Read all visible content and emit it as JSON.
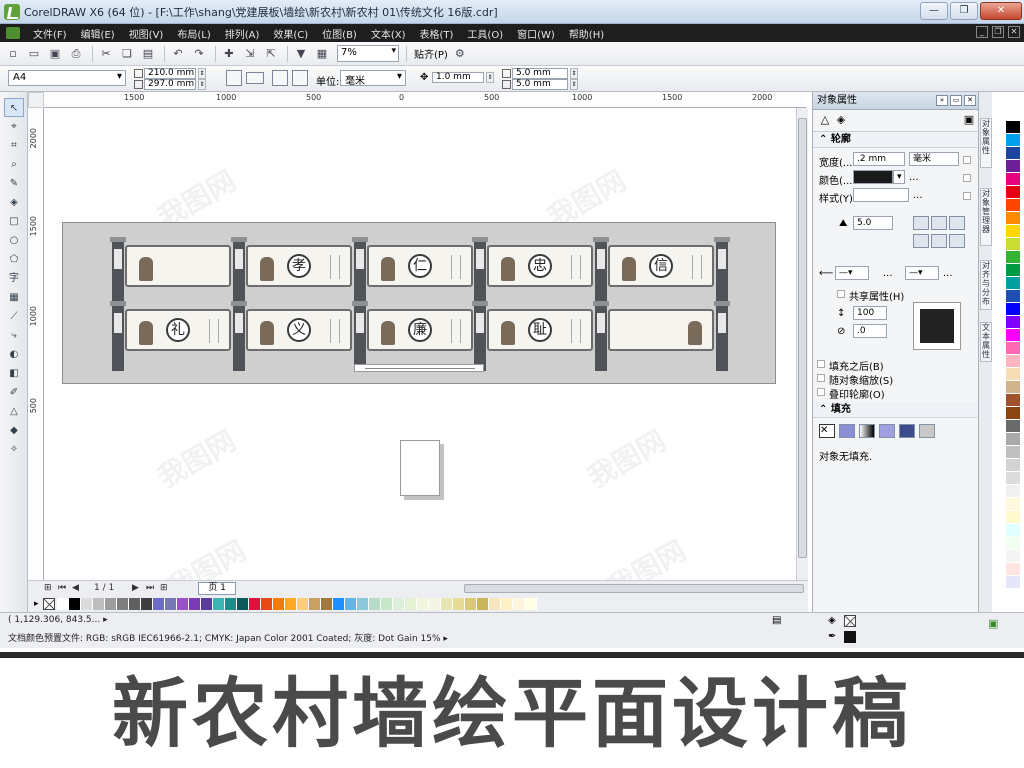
{
  "window": {
    "title": "CorelDRAW X6 (64 位) - [F:\\工作\\shang\\党建展板\\墙绘\\新农村\\新农村 01\\传统文化 16版.cdr]",
    "controls": [
      "—",
      "❐",
      "✕"
    ]
  },
  "menu": {
    "items": [
      "文件(F)",
      "编辑(E)",
      "视图(V)",
      "布局(L)",
      "排列(A)",
      "效果(C)",
      "位图(B)",
      "文本(X)",
      "表格(T)",
      "工具(O)",
      "窗口(W)",
      "帮助(H)"
    ]
  },
  "toolbar": {
    "zoom": "7%",
    "snap_label": "贴齐(P)"
  },
  "property_bar": {
    "page_size": "A4",
    "width": "210.0 mm",
    "height": "297.0 mm",
    "unit_label": "单位:",
    "unit_value": "毫米",
    "nudge": "1.0 mm",
    "dup_x": "5.0 mm",
    "dup_y": "5.0 mm"
  },
  "rulers": {
    "h_ticks": [
      "1500",
      "1000",
      "500",
      "0",
      "500",
      "1000",
      "1500",
      "2000"
    ],
    "v_ticks": [
      "2000",
      "1500",
      "1000",
      "500"
    ]
  },
  "canvas": {
    "row1_chars": [
      "",
      "孝",
      "仁",
      "忠",
      "信"
    ],
    "row2_chars": [
      "礼",
      "义",
      "廉",
      "耻",
      ""
    ],
    "watermark": "我图网"
  },
  "page_nav": {
    "counter": "1 / 1",
    "tab": "页 1"
  },
  "docker": {
    "title": "对象属性",
    "outline_section": "轮廓",
    "width_label": "宽度(...",
    "width_value": ".2 mm",
    "width_unit": "毫米",
    "color_label": "颜色(...",
    "style_label": "样式(Y):",
    "miter_value": "5.0",
    "share_attr": "共享属性(H)",
    "arrow_size": "100",
    "arrow_angle": ".0",
    "fill_behind": "填充之后(B)",
    "scale_with": "随对象缩放(S)",
    "overprint": "叠印轮廓(O)",
    "fill_section": "填充",
    "no_fill_text": "对象无填充."
  },
  "vtabs": [
    "对象属性",
    "对象管理器",
    "对齐与分布",
    "文本属性"
  ],
  "status": {
    "coords": "( 1,129.306, 843.5... ▸",
    "profile": "文档颜色预置文件: RGB: sRGB IEC61966-2.1; CMYK: Japan Color 2001 Coated; 灰度: Dot Gain 15% ▸"
  },
  "banner": {
    "text": "新农村墙绘平面设计稿"
  },
  "colors": {
    "palette": [
      "#ffffff",
      "#000000",
      "#dcdcdc",
      "#bdbdbd",
      "#9e9e9e",
      "#7f7f7f",
      "#5f5f5f",
      "#3f3f3f",
      "#6c6cc8",
      "#7878b4",
      "#9c50c8",
      "#7c3cb4",
      "#5a3c9c",
      "#3cb4b4",
      "#1e8c8c",
      "#0a5a5a",
      "#dc143c",
      "#e64a19",
      "#f57c00",
      "#ffa726",
      "#ffcc80",
      "#c8a064",
      "#a07840",
      "#1e90ff",
      "#64b4e6",
      "#8cc8dc",
      "#b4dcc8",
      "#c8e6c8",
      "#dceedc",
      "#e6f0d2",
      "#f0f5dc",
      "#f5f5e6",
      "#e6e6b4",
      "#e6dc96",
      "#dcc878",
      "#c8b45a",
      "#f5e6be",
      "#fff0c8",
      "#fff5dc",
      "#ffffe6"
    ],
    "vpalette": [
      "#ffffff",
      "#000000",
      "#00a0e9",
      "#1e46a0",
      "#6e1e96",
      "#e6007e",
      "#e60012",
      "#ff4500",
      "#ff8c00",
      "#ffd700",
      "#c8dc32",
      "#32b432",
      "#009944",
      "#00a0a0",
      "#1e50b4",
      "#0000ff",
      "#8000ff",
      "#ff00ff",
      "#ff69b4",
      "#ffb6c1",
      "#f5deb3",
      "#d2b48c",
      "#a0522d",
      "#8b4513",
      "#696969",
      "#a9a9a9",
      "#c0c0c0",
      "#d3d3d3",
      "#dcdcdc",
      "#f0f0f0",
      "#fff8dc",
      "#fffacd",
      "#e0ffff",
      "#f0fff0",
      "#f5f5f5",
      "#ffe4e1",
      "#e6e6fa"
    ]
  }
}
